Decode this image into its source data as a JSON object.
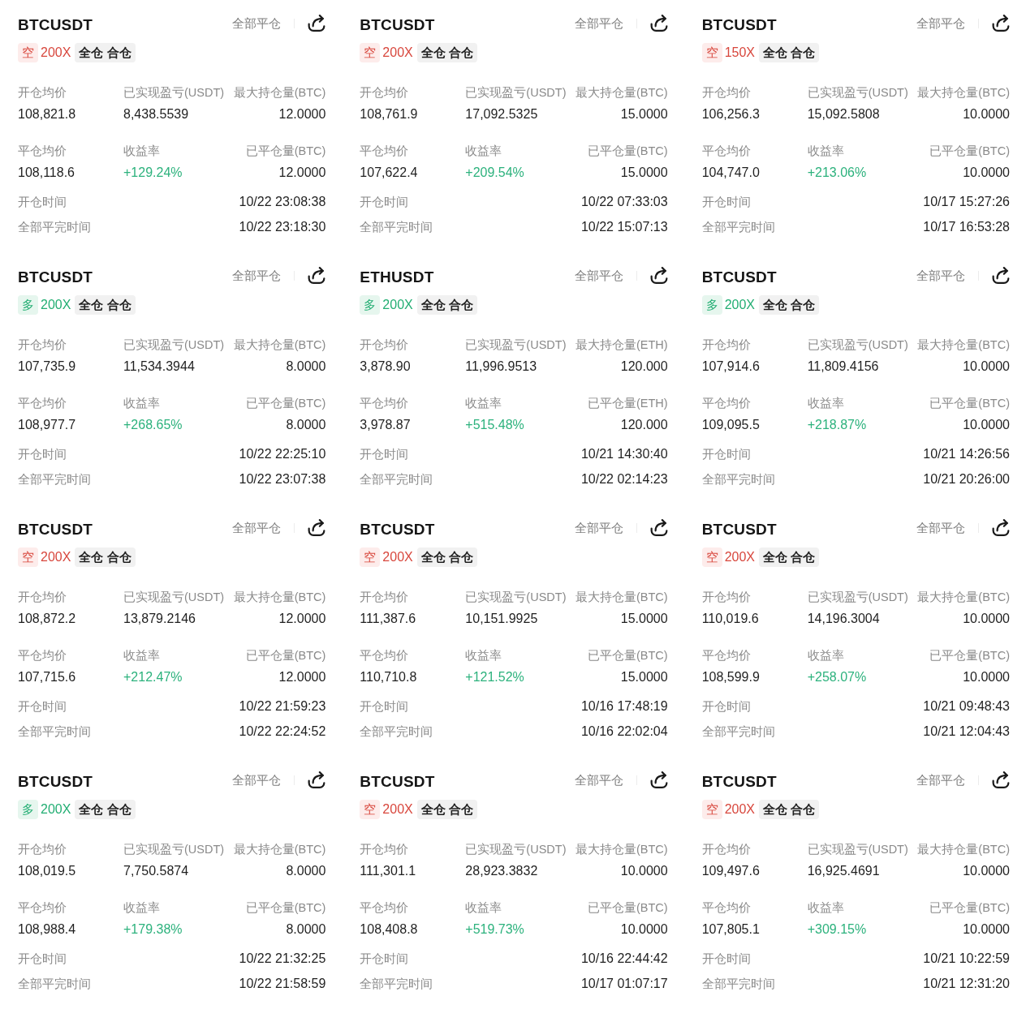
{
  "cards": [
    {
      "symbol": "BTCUSDT",
      "close_all": "全部平仓",
      "side": {
        "label": "空",
        "kind": "short"
      },
      "leverage": "200X",
      "margin_mode": "全仓 合仓",
      "stats": [
        {
          "label": "开仓均价",
          "value": "108,821.8",
          "kind": "number"
        },
        {
          "label": "已实现盈亏(USDT)",
          "value": "8,438.5539",
          "kind": "number"
        },
        {
          "label": "最大持仓量(BTC)",
          "value": "12.0000",
          "kind": "number"
        },
        {
          "label": "平仓均价",
          "value": "108,118.6",
          "kind": "number"
        },
        {
          "label": "收益率",
          "value": "+129.24%",
          "kind": "rate"
        },
        {
          "label": "已平仓量(BTC)",
          "value": "12.0000",
          "kind": "number"
        }
      ],
      "times": [
        {
          "label": "开仓时间",
          "value": "10/22 23:08:38"
        },
        {
          "label": "全部平完时间",
          "value": "10/22 23:18:30"
        }
      ]
    },
    {
      "symbol": "BTCUSDT",
      "close_all": "全部平仓",
      "side": {
        "label": "空",
        "kind": "short"
      },
      "leverage": "200X",
      "margin_mode": "全仓 合仓",
      "stats": [
        {
          "label": "开仓均价",
          "value": "108,761.9",
          "kind": "number"
        },
        {
          "label": "已实现盈亏(USDT)",
          "value": "17,092.5325",
          "kind": "number"
        },
        {
          "label": "最大持仓量(BTC)",
          "value": "15.0000",
          "kind": "number"
        },
        {
          "label": "平仓均价",
          "value": "107,622.4",
          "kind": "number"
        },
        {
          "label": "收益率",
          "value": "+209.54%",
          "kind": "rate"
        },
        {
          "label": "已平仓量(BTC)",
          "value": "15.0000",
          "kind": "number"
        }
      ],
      "times": [
        {
          "label": "开仓时间",
          "value": "10/22 07:33:03"
        },
        {
          "label": "全部平完时间",
          "value": "10/22 15:07:13"
        }
      ]
    },
    {
      "symbol": "BTCUSDT",
      "close_all": "全部平仓",
      "side": {
        "label": "空",
        "kind": "short"
      },
      "leverage": "150X",
      "margin_mode": "全仓 合仓",
      "stats": [
        {
          "label": "开仓均价",
          "value": "106,256.3",
          "kind": "number"
        },
        {
          "label": "已实现盈亏(USDT)",
          "value": "15,092.5808",
          "kind": "number"
        },
        {
          "label": "最大持仓量(BTC)",
          "value": "10.0000",
          "kind": "number"
        },
        {
          "label": "平仓均价",
          "value": "104,747.0",
          "kind": "number"
        },
        {
          "label": "收益率",
          "value": "+213.06%",
          "kind": "rate"
        },
        {
          "label": "已平仓量(BTC)",
          "value": "10.0000",
          "kind": "number"
        }
      ],
      "times": [
        {
          "label": "开仓时间",
          "value": "10/17 15:27:26"
        },
        {
          "label": "全部平完时间",
          "value": "10/17 16:53:28"
        }
      ]
    },
    {
      "symbol": "BTCUSDT",
      "close_all": "全部平仓",
      "side": {
        "label": "多",
        "kind": "long"
      },
      "leverage": "200X",
      "margin_mode": "全仓 合仓",
      "stats": [
        {
          "label": "开仓均价",
          "value": "107,735.9",
          "kind": "number"
        },
        {
          "label": "已实现盈亏(USDT)",
          "value": "11,534.3944",
          "kind": "number"
        },
        {
          "label": "最大持仓量(BTC)",
          "value": "8.0000",
          "kind": "number"
        },
        {
          "label": "平仓均价",
          "value": "108,977.7",
          "kind": "number"
        },
        {
          "label": "收益率",
          "value": "+268.65%",
          "kind": "rate"
        },
        {
          "label": "已平仓量(BTC)",
          "value": "8.0000",
          "kind": "number"
        }
      ],
      "times": [
        {
          "label": "开仓时间",
          "value": "10/22 22:25:10"
        },
        {
          "label": "全部平完时间",
          "value": "10/22 23:07:38"
        }
      ]
    },
    {
      "symbol": "ETHUSDT",
      "close_all": "全部平仓",
      "side": {
        "label": "多",
        "kind": "long"
      },
      "leverage": "200X",
      "margin_mode": "全仓 合仓",
      "stats": [
        {
          "label": "开仓均价",
          "value": "3,878.90",
          "kind": "number"
        },
        {
          "label": "已实现盈亏(USDT)",
          "value": "11,996.9513",
          "kind": "number"
        },
        {
          "label": "最大持仓量(ETH)",
          "value": "120.000",
          "kind": "number"
        },
        {
          "label": "平仓均价",
          "value": "3,978.87",
          "kind": "number"
        },
        {
          "label": "收益率",
          "value": "+515.48%",
          "kind": "rate"
        },
        {
          "label": "已平仓量(ETH)",
          "value": "120.000",
          "kind": "number"
        }
      ],
      "times": [
        {
          "label": "开仓时间",
          "value": "10/21 14:30:40"
        },
        {
          "label": "全部平完时间",
          "value": "10/22 02:14:23"
        }
      ]
    },
    {
      "symbol": "BTCUSDT",
      "close_all": "全部平仓",
      "side": {
        "label": "多",
        "kind": "long"
      },
      "leverage": "200X",
      "margin_mode": "全仓 合仓",
      "stats": [
        {
          "label": "开仓均价",
          "value": "107,914.6",
          "kind": "number"
        },
        {
          "label": "已实现盈亏(USDT)",
          "value": "11,809.4156",
          "kind": "number"
        },
        {
          "label": "最大持仓量(BTC)",
          "value": "10.0000",
          "kind": "number"
        },
        {
          "label": "平仓均价",
          "value": "109,095.5",
          "kind": "number"
        },
        {
          "label": "收益率",
          "value": "+218.87%",
          "kind": "rate"
        },
        {
          "label": "已平仓量(BTC)",
          "value": "10.0000",
          "kind": "number"
        }
      ],
      "times": [
        {
          "label": "开仓时间",
          "value": "10/21 14:26:56"
        },
        {
          "label": "全部平完时间",
          "value": "10/21 20:26:00"
        }
      ]
    },
    {
      "symbol": "BTCUSDT",
      "close_all": "全部平仓",
      "side": {
        "label": "空",
        "kind": "short"
      },
      "leverage": "200X",
      "margin_mode": "全仓 合仓",
      "stats": [
        {
          "label": "开仓均价",
          "value": "108,872.2",
          "kind": "number"
        },
        {
          "label": "已实现盈亏(USDT)",
          "value": "13,879.2146",
          "kind": "number"
        },
        {
          "label": "最大持仓量(BTC)",
          "value": "12.0000",
          "kind": "number"
        },
        {
          "label": "平仓均价",
          "value": "107,715.6",
          "kind": "number"
        },
        {
          "label": "收益率",
          "value": "+212.47%",
          "kind": "rate"
        },
        {
          "label": "已平仓量(BTC)",
          "value": "12.0000",
          "kind": "number"
        }
      ],
      "times": [
        {
          "label": "开仓时间",
          "value": "10/22 21:59:23"
        },
        {
          "label": "全部平完时间",
          "value": "10/22 22:24:52"
        }
      ]
    },
    {
      "symbol": "BTCUSDT",
      "close_all": "全部平仓",
      "side": {
        "label": "空",
        "kind": "short"
      },
      "leverage": "200X",
      "margin_mode": "全仓 合仓",
      "stats": [
        {
          "label": "开仓均价",
          "value": "111,387.6",
          "kind": "number"
        },
        {
          "label": "已实现盈亏(USDT)",
          "value": "10,151.9925",
          "kind": "number"
        },
        {
          "label": "最大持仓量(BTC)",
          "value": "15.0000",
          "kind": "number"
        },
        {
          "label": "平仓均价",
          "value": "110,710.8",
          "kind": "number"
        },
        {
          "label": "收益率",
          "value": "+121.52%",
          "kind": "rate"
        },
        {
          "label": "已平仓量(BTC)",
          "value": "15.0000",
          "kind": "number"
        }
      ],
      "times": [
        {
          "label": "开仓时间",
          "value": "10/16 17:48:19"
        },
        {
          "label": "全部平完时间",
          "value": "10/16 22:02:04"
        }
      ]
    },
    {
      "symbol": "BTCUSDT",
      "close_all": "全部平仓",
      "side": {
        "label": "空",
        "kind": "short"
      },
      "leverage": "200X",
      "margin_mode": "全仓 合仓",
      "stats": [
        {
          "label": "开仓均价",
          "value": "110,019.6",
          "kind": "number"
        },
        {
          "label": "已实现盈亏(USDT)",
          "value": "14,196.3004",
          "kind": "number"
        },
        {
          "label": "最大持仓量(BTC)",
          "value": "10.0000",
          "kind": "number"
        },
        {
          "label": "平仓均价",
          "value": "108,599.9",
          "kind": "number"
        },
        {
          "label": "收益率",
          "value": "+258.07%",
          "kind": "rate"
        },
        {
          "label": "已平仓量(BTC)",
          "value": "10.0000",
          "kind": "number"
        }
      ],
      "times": [
        {
          "label": "开仓时间",
          "value": "10/21 09:48:43"
        },
        {
          "label": "全部平完时间",
          "value": "10/21 12:04:43"
        }
      ]
    },
    {
      "symbol": "BTCUSDT",
      "close_all": "全部平仓",
      "side": {
        "label": "多",
        "kind": "long"
      },
      "leverage": "200X",
      "margin_mode": "全仓 合仓",
      "stats": [
        {
          "label": "开仓均价",
          "value": "108,019.5",
          "kind": "number"
        },
        {
          "label": "已实现盈亏(USDT)",
          "value": "7,750.5874",
          "kind": "number"
        },
        {
          "label": "最大持仓量(BTC)",
          "value": "8.0000",
          "kind": "number"
        },
        {
          "label": "平仓均价",
          "value": "108,988.4",
          "kind": "number"
        },
        {
          "label": "收益率",
          "value": "+179.38%",
          "kind": "rate"
        },
        {
          "label": "已平仓量(BTC)",
          "value": "8.0000",
          "kind": "number"
        }
      ],
      "times": [
        {
          "label": "开仓时间",
          "value": "10/22 21:32:25"
        },
        {
          "label": "全部平完时间",
          "value": "10/22 21:58:59"
        }
      ]
    },
    {
      "symbol": "BTCUSDT",
      "close_all": "全部平仓",
      "side": {
        "label": "空",
        "kind": "short"
      },
      "leverage": "200X",
      "margin_mode": "全仓 合仓",
      "stats": [
        {
          "label": "开仓均价",
          "value": "111,301.1",
          "kind": "number"
        },
        {
          "label": "已实现盈亏(USDT)",
          "value": "28,923.3832",
          "kind": "number"
        },
        {
          "label": "最大持仓量(BTC)",
          "value": "10.0000",
          "kind": "number"
        },
        {
          "label": "平仓均价",
          "value": "108,408.8",
          "kind": "number"
        },
        {
          "label": "收益率",
          "value": "+519.73%",
          "kind": "rate"
        },
        {
          "label": "已平仓量(BTC)",
          "value": "10.0000",
          "kind": "number"
        }
      ],
      "times": [
        {
          "label": "开仓时间",
          "value": "10/16 22:44:42"
        },
        {
          "label": "全部平完时间",
          "value": "10/17 01:07:17"
        }
      ]
    },
    {
      "symbol": "BTCUSDT",
      "close_all": "全部平仓",
      "side": {
        "label": "空",
        "kind": "short"
      },
      "leverage": "200X",
      "margin_mode": "全仓 合仓",
      "stats": [
        {
          "label": "开仓均价",
          "value": "109,497.6",
          "kind": "number"
        },
        {
          "label": "已实现盈亏(USDT)",
          "value": "16,925.4691",
          "kind": "number"
        },
        {
          "label": "最大持仓量(BTC)",
          "value": "10.0000",
          "kind": "number"
        },
        {
          "label": "平仓均价",
          "value": "107,805.1",
          "kind": "number"
        },
        {
          "label": "收益率",
          "value": "+309.15%",
          "kind": "rate"
        },
        {
          "label": "已平仓量(BTC)",
          "value": "10.0000",
          "kind": "number"
        }
      ],
      "times": [
        {
          "label": "开仓时间",
          "value": "10/21 10:22:59"
        },
        {
          "label": "全部平完时间",
          "value": "10/21 12:31:20"
        }
      ]
    }
  ]
}
